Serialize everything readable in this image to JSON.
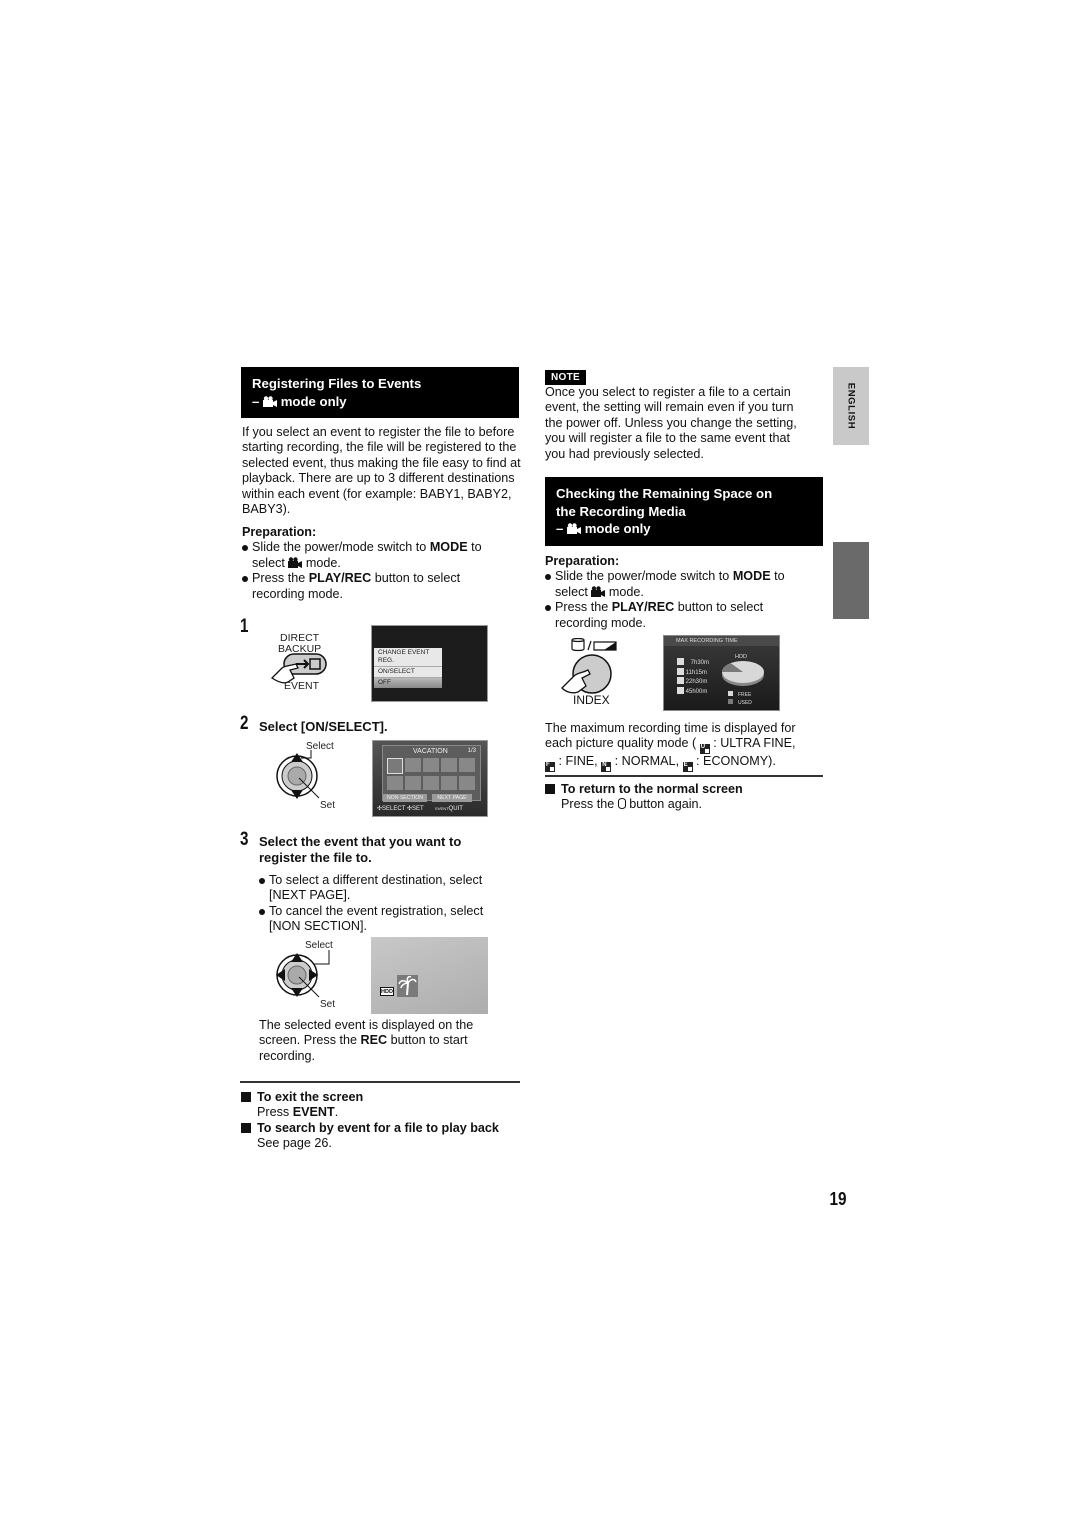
{
  "left": {
    "section1": {
      "title_line1": "Registering Files to Events",
      "title_line2_prefix": "–",
      "title_line2_suffix": "mode only",
      "mode_icon": "video-camera-icon"
    },
    "intro": "If you select an event to register the file to before starting recording, the file will be registered to the selected event, thus making the file easy to find at playback. There are up to 3 different destinations within each event (for example: BABY1, BABY2, BABY3).",
    "preparation": {
      "label": "Preparation:",
      "bullet1": {
        "pre": "Slide the power/mode switch to ",
        "bold": "MODE",
        "post": " to",
        "line2_pre": "select ",
        "line2_post": " mode."
      },
      "bullet2": {
        "pre": "Press the ",
        "bold": "PLAY/REC",
        "post": " button to select",
        "line2": "recording mode."
      }
    },
    "step1": {
      "number": "1",
      "button_label_top1": "DIRECT",
      "button_label_top2": "BACKUP",
      "button_label_bottom": "EVENT",
      "menu": [
        "CHANGE EVENT REG.",
        "ON/SELECT",
        "OFF"
      ],
      "menu_selected": "OFF"
    },
    "step2": {
      "number": "2",
      "title": "Select [ON/SELECT].",
      "dial_select": "Select",
      "dial_set": "Set",
      "screen": {
        "title": "VACATION",
        "page": "1/3",
        "buttons": [
          "NON SECTION",
          "NEXT PAGE"
        ],
        "footer_select": "SELECT",
        "footer_set": "SET",
        "footer_event": "EVENT",
        "footer_quit": "QUIT"
      }
    },
    "step3": {
      "number": "3",
      "title_line1": "Select the event that you want to",
      "title_line2": "register the file to.",
      "bullet1_line1": "To select a different destination, select",
      "bullet1_line2": "[NEXT PAGE].",
      "bullet2_line1": "To cancel the event registration, select",
      "bullet2_line2": "[NON SECTION].",
      "dial_select": "Select",
      "dial_set": "Set",
      "screen_badge": "HDD",
      "desc_line1": "The selected event is displayed on the",
      "desc_line2_pre": "screen. Press the ",
      "desc_line2_bold": "REC",
      "desc_line2_post": " button to start",
      "desc_line3": "recording."
    },
    "exit": {
      "title": "To exit the screen",
      "body_pre": "Press ",
      "body_bold": "EVENT",
      "body_post": "."
    },
    "search": {
      "title": "To search by event for a file to play back",
      "body": "See page 26."
    }
  },
  "right": {
    "note": {
      "tag": "NOTE",
      "lines": [
        "Once you select to register a file to a certain",
        "event, the setting will remain even if you turn",
        "the power off. Unless you change the setting,",
        "you will register a file to the same event that",
        "you had previously selected."
      ]
    },
    "section2": {
      "title_line1": "Checking the Remaining Space on",
      "title_line2": "the Recording Media",
      "title_line3_prefix": "–",
      "title_line3_suffix": "mode only"
    },
    "preparation": {
      "label": "Preparation:",
      "bullet1": {
        "pre": "Slide the power/mode switch to ",
        "bold": "MODE",
        "post": " to",
        "line2_pre": "select ",
        "line2_post": " mode."
      },
      "bullet2": {
        "pre": "Press the ",
        "bold": "PLAY/REC",
        "post": " button to select",
        "line2": "recording mode."
      }
    },
    "index_button_label": "INDEX",
    "recording_screen": {
      "title": "MAX RECORDING TIME",
      "media": "HDD",
      "times": [
        {
          "mode": "U",
          "value": "7h30m"
        },
        {
          "mode": "F",
          "value": "11h15m"
        },
        {
          "mode": "N",
          "value": "22h30m"
        },
        {
          "mode": "E",
          "value": "45h00m"
        }
      ],
      "legend_free": "FREE",
      "legend_used": "USED",
      "used_fraction": 0.15
    },
    "desc": {
      "line1": "The maximum recording time is displayed for",
      "line2_pre": "each picture quality mode ( ",
      "line2_post": " : ULTRA FINE,",
      "fine": " : FINE, ",
      "normal": " : NORMAL, ",
      "economy": " : ECONOMY)."
    },
    "return": {
      "title": "To return to the normal screen",
      "body_pre": "Press the ",
      "body_post": " button again."
    }
  },
  "sidebar": {
    "language_tab": "ENGLISH"
  },
  "page_number": "19"
}
